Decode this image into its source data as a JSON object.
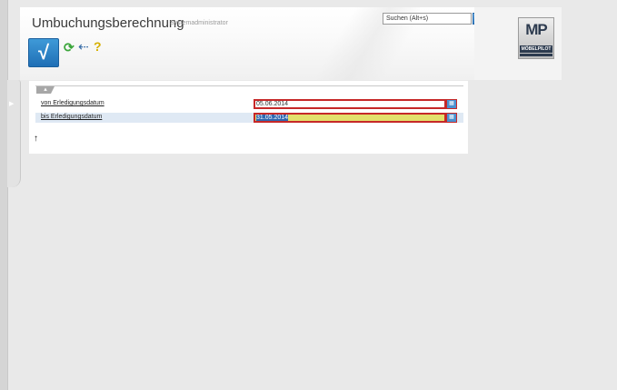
{
  "header": {
    "title": "Umbuchungsberechnung",
    "subtitle": "Systemadministrator"
  },
  "search": {
    "placeholder": "Suchen (Alt+s)"
  },
  "logo": {
    "text": "MP",
    "caption": "MÖBELPILOT"
  },
  "toolbar": {
    "apply_icon": "checkmark-icon",
    "refresh_icon": "refresh-icon",
    "back_icon": "back-arrow-icon",
    "help_icon": "help-icon"
  },
  "form": {
    "rows": [
      {
        "label": "von Erledigungsdatum",
        "value": "05.06.2014"
      },
      {
        "label": "bis Erledigungsdatum",
        "value": "31.05.2014"
      }
    ]
  },
  "colors": {
    "accent": "#1f6fb5",
    "error_border": "#c62828",
    "active_field": "#e2e06c"
  }
}
